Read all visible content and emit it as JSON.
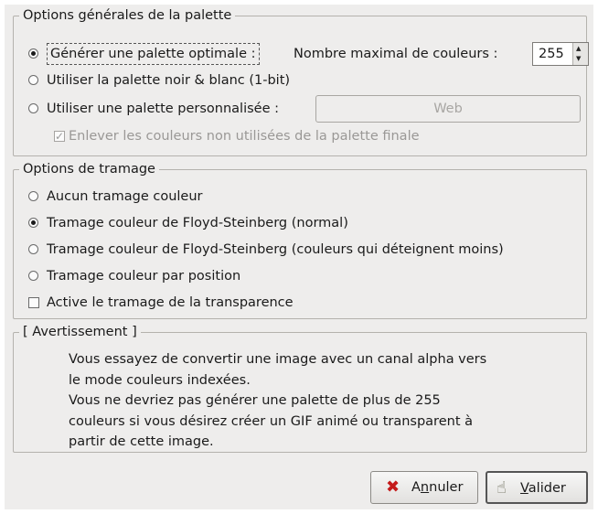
{
  "palette_frame": {
    "title": "Options générales de la palette",
    "generate_optimal": "Générer une palette optimale :",
    "max_colors_label": "Nombre maximal de couleurs :",
    "max_colors_value": "255",
    "bw_palette": "Utiliser la palette noir & blanc (1-bit)",
    "custom_palette": "Utiliser une palette personnalisée :",
    "custom_palette_button": "Web",
    "remove_unused": "Enlever les couleurs non utilisées de la palette finale",
    "selected": "generate_optimal"
  },
  "dither_frame": {
    "title": "Options de tramage",
    "options": [
      "Aucun tramage couleur",
      "Tramage couleur de Floyd-Steinberg (normal)",
      "Tramage couleur de Floyd-Steinberg (couleurs qui déteignent moins)",
      "Tramage couleur par position"
    ],
    "selected_index": 1,
    "transparency_dither": "Active le tramage de la transparence"
  },
  "warning_frame": {
    "title": "[ Avertissement ]",
    "lines": [
      "Vous essayez de convertir une image avec un canal alpha vers",
      "le mode couleurs indexées.",
      "Vous ne devriez pas générer une palette de plus de 255",
      "couleurs si vous désirez créer un GIF animé ou transparent à",
      "partir de cette image."
    ]
  },
  "buttons": {
    "cancel_prefix": "A",
    "cancel_mnemonic": "n",
    "cancel_rest": "nuler",
    "ok_mnemonic": "V",
    "ok_rest": "alider"
  },
  "icons": {
    "cancel_icon": "red-x-icon",
    "ok_icon": "hand-ok-icon"
  },
  "colors": {
    "dialog_bg": "#eeedec",
    "cancel_icon": "#c41a1a"
  }
}
